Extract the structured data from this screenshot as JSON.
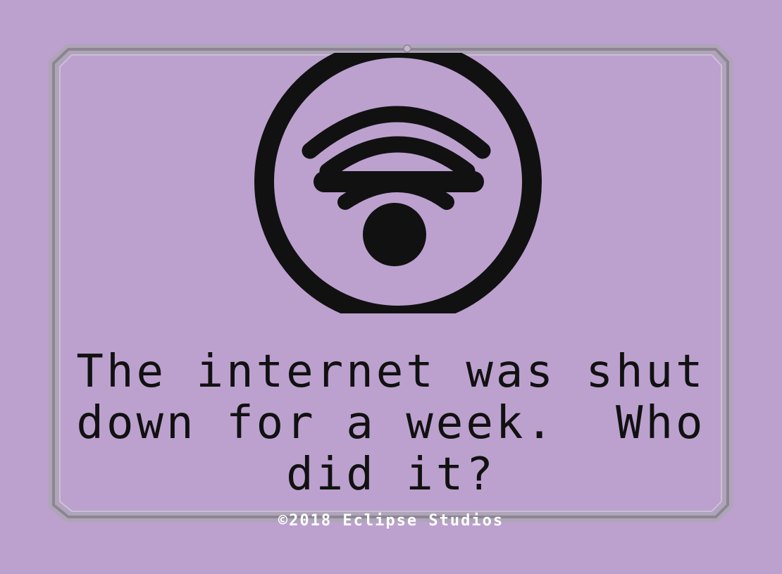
{
  "card": {
    "question": "The internet was shut down for a week.  Who did it?",
    "copyright": "©2018 Eclipse Studios"
  },
  "colors": {
    "background": "#bca1cf",
    "frame": "#8f8696",
    "icon": "#111111",
    "copyright": "#ffffff"
  },
  "icon": {
    "name": "wifi-crossed-circle-icon"
  }
}
